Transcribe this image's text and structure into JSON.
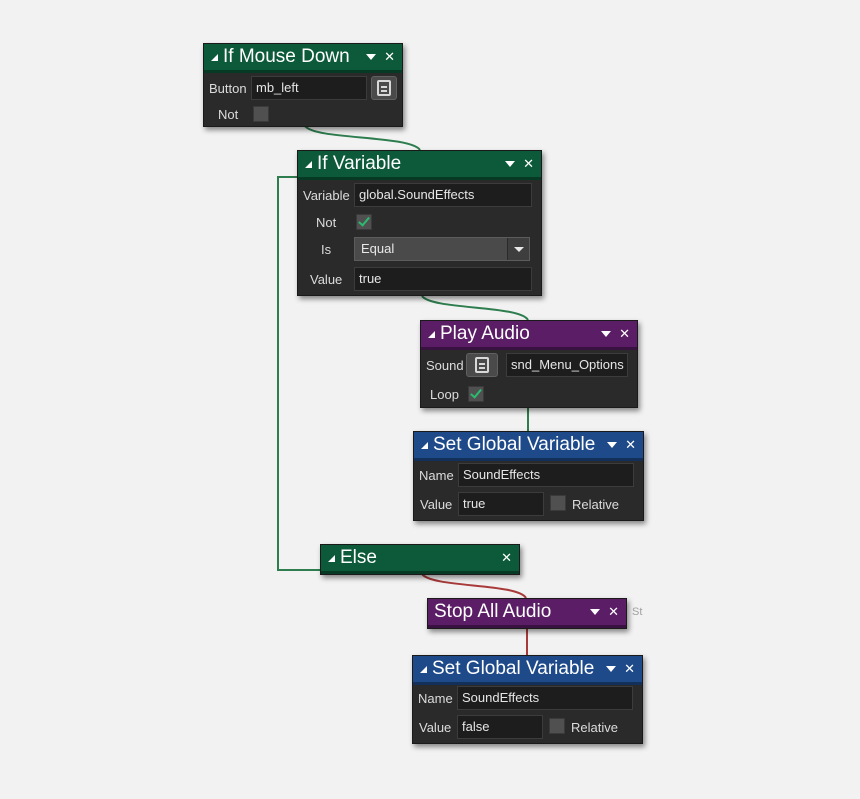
{
  "blocks": {
    "if_mouse_down": {
      "title": "If Mouse Down",
      "button_label": "Button",
      "button_value": "mb_left",
      "not_label": "Not",
      "not_checked": false
    },
    "if_variable": {
      "title": "If Variable",
      "variable_label": "Variable",
      "variable_value": "global.SoundEffects",
      "not_label": "Not",
      "not_checked": true,
      "is_label": "Is",
      "is_value": "Equal",
      "value_label": "Value",
      "value_value": "true"
    },
    "play_audio": {
      "title": "Play Audio",
      "sound_label": "Sound",
      "sound_value": "snd_Menu_Options",
      "loop_label": "Loop",
      "loop_checked": true
    },
    "set_global_1": {
      "title": "Set Global Variable",
      "name_label": "Name",
      "name_value": "SoundEffects",
      "value_label": "Value",
      "value_value": "true",
      "relative_label": "Relative",
      "relative_checked": false
    },
    "else": {
      "title": "Else"
    },
    "stop_all_audio": {
      "title": "Stop All Audio",
      "tail_text": "St"
    },
    "set_global_2": {
      "title": "Set Global Variable",
      "name_label": "Name",
      "name_value": "SoundEffects",
      "value_label": "Value",
      "value_value": "false",
      "relative_label": "Relative",
      "relative_checked": false
    }
  },
  "colors": {
    "event_green": "#0c5a3a",
    "audio_purple": "#5a1d66",
    "variable_blue": "#1e4a8a",
    "wire_green": "#2e7d4f",
    "wire_red": "#a83a3a"
  }
}
